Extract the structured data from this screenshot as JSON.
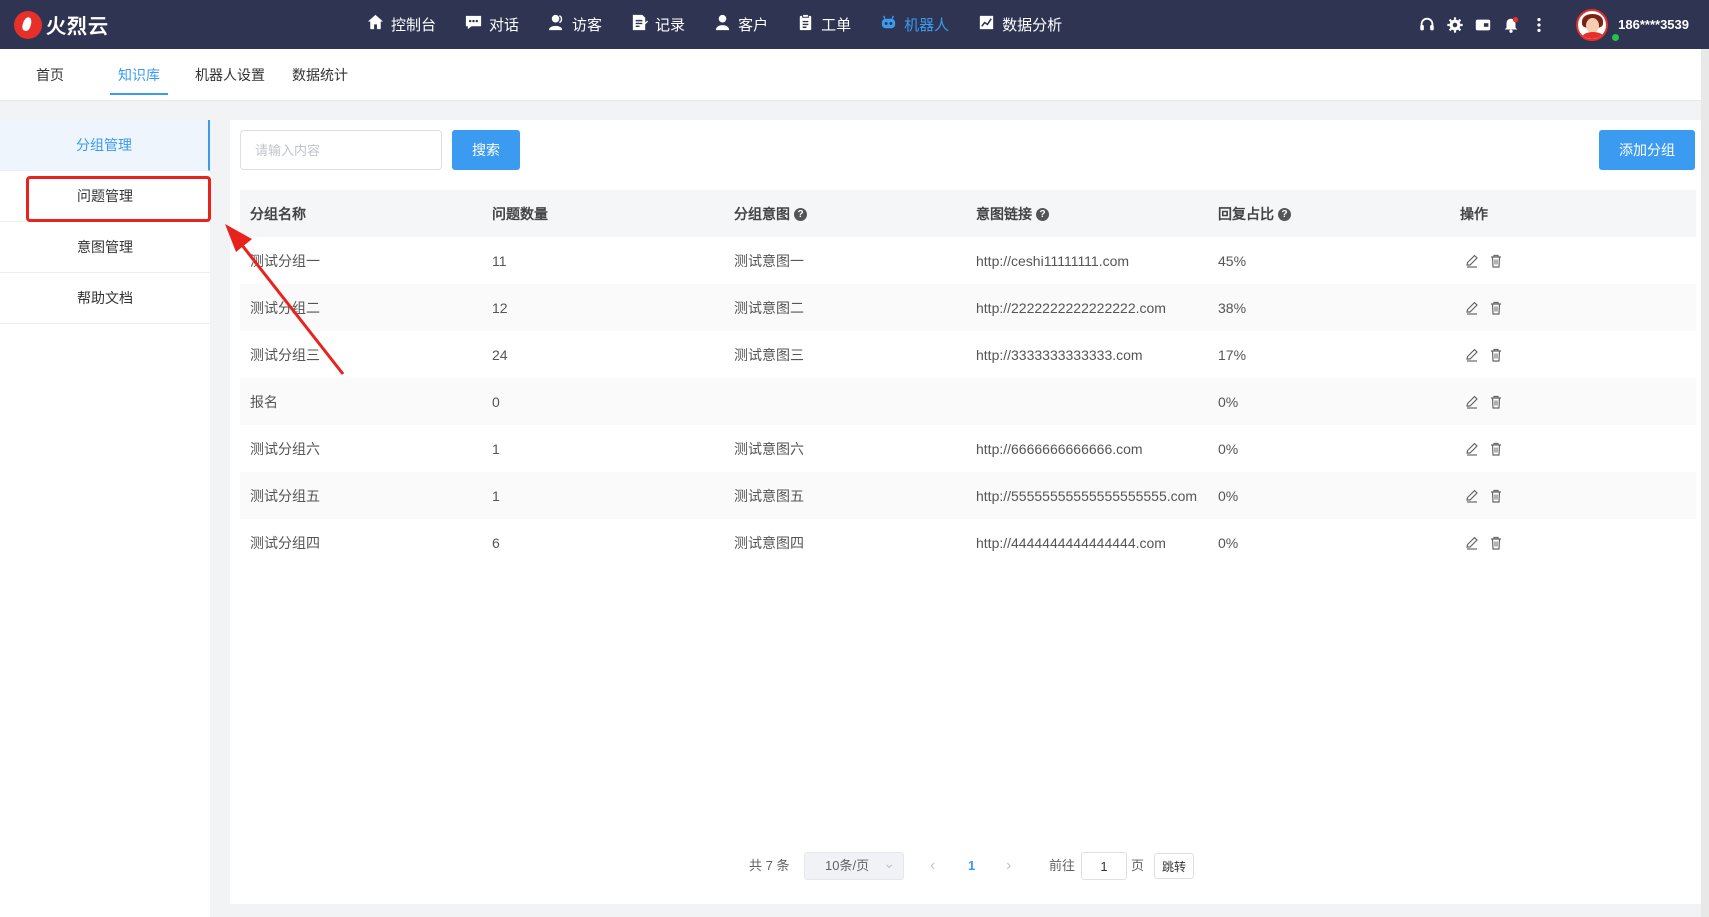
{
  "app": {
    "logo_text": "火烈云"
  },
  "topnav": [
    {
      "label": "控制台",
      "icon": "home-icon"
    },
    {
      "label": "对话",
      "icon": "chat-icon"
    },
    {
      "label": "访客",
      "icon": "visitor-icon"
    },
    {
      "label": "记录",
      "icon": "record-icon"
    },
    {
      "label": "客户",
      "icon": "customer-icon"
    },
    {
      "label": "工单",
      "icon": "ticket-icon"
    },
    {
      "label": "机器人",
      "icon": "robot-icon",
      "active": true
    },
    {
      "label": "数据分析",
      "icon": "chart-icon"
    }
  ],
  "user": {
    "phone": "186****3539"
  },
  "subnav": [
    {
      "label": "首页"
    },
    {
      "label": "知识库",
      "active": true
    },
    {
      "label": "机器人设置"
    },
    {
      "label": "数据统计"
    }
  ],
  "sidebar": [
    {
      "label": "分组管理",
      "active": true
    },
    {
      "label": "问题管理",
      "highlighted": true
    },
    {
      "label": "意图管理"
    },
    {
      "label": "帮助文档"
    }
  ],
  "toolbar": {
    "search_placeholder": "请输入内容",
    "search_label": "搜索",
    "add_label": "添加分组"
  },
  "table": {
    "headers": [
      "分组名称",
      "问题数量",
      "分组意图",
      "意图链接",
      "回复占比",
      "操作"
    ],
    "help_headers": [
      2,
      3,
      4
    ],
    "rows": [
      [
        "测试分组一",
        "11",
        "测试意图一",
        "http://ceshi11111111.com",
        "45%"
      ],
      [
        "测试分组二",
        "12",
        "测试意图二",
        "http://2222222222222222.com",
        "38%"
      ],
      [
        "测试分组三",
        "24",
        "测试意图三",
        "http://3333333333333.com",
        "17%"
      ],
      [
        "报名",
        "0",
        "",
        "",
        "0%"
      ],
      [
        "测试分组六",
        "1",
        "测试意图六",
        "http://6666666666666.com",
        "0%"
      ],
      [
        "测试分组五",
        "1",
        "测试意图五",
        "http://55555555555555555555.com",
        "0%"
      ],
      [
        "测试分组四",
        "6",
        "测试意图四",
        "http://4444444444444444.com",
        "0%"
      ]
    ]
  },
  "pagination": {
    "total_text": "共 7 条",
    "page_size": "10条/页",
    "current_page": "1",
    "goto_prefix": "前往",
    "goto_value": "1",
    "goto_suffix": "页",
    "jump_label": "跳转"
  },
  "colors": {
    "topbar": "#2f3452",
    "accent": "#3a9bf0",
    "annotation": "#e8231d"
  }
}
